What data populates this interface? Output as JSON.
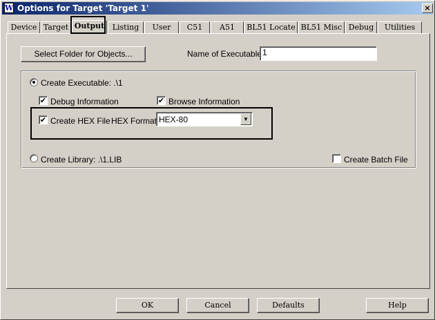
{
  "window": {
    "title": "Options for Target 'Target 1'",
    "app_icon": "W",
    "close_glyph": "×"
  },
  "tabs": [
    {
      "label": "Device"
    },
    {
      "label": "Target"
    },
    {
      "label": "Output"
    },
    {
      "label": "Listing"
    },
    {
      "label": "User"
    },
    {
      "label": "C51"
    },
    {
      "label": "A51"
    },
    {
      "label": "BL51 Locate"
    },
    {
      "label": "BL51 Misc"
    },
    {
      "label": "Debug"
    },
    {
      "label": "Utilities"
    }
  ],
  "active_tab": "Output",
  "output": {
    "select_folder_label": "Select Folder for Objects...",
    "name_of_exe_label": "Name of Executable:",
    "name_of_exe_value": "1",
    "create_exe_label": "Create Executable:  .\\1",
    "debug_info_label": "Debug Information",
    "browse_info_label": "Browse Information",
    "create_hex_label": "Create HEX File",
    "hex_format_label": "HEX Format:",
    "hex_format_value": "HEX-80",
    "create_lib_label": "Create Library:  .\\1.LIB",
    "create_batch_label": "Create Batch File",
    "check_glyph": "✔"
  },
  "footer": {
    "ok_label": "OK",
    "cancel_label": "Cancel",
    "defaults_label": "Defaults",
    "help_label": "Help"
  }
}
